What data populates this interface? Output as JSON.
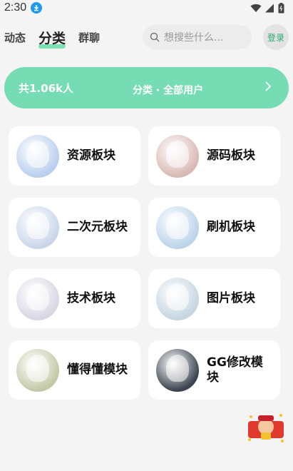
{
  "status": {
    "time": "2:30"
  },
  "header": {
    "tabs": [
      {
        "label": "动态",
        "active": false
      },
      {
        "label": "分类",
        "active": true
      },
      {
        "label": "群聊",
        "active": false
      }
    ],
    "search_placeholder": "想搜些什么...",
    "login_label": "登录"
  },
  "banner": {
    "count_text": "共1.06k人",
    "title": "分类 · 全部用户"
  },
  "categories": [
    {
      "label": "资源板块",
      "avatar_color": "#b9cfee"
    },
    {
      "label": "源码板块",
      "avatar_color": "#d8b9b4"
    },
    {
      "label": "二次元板块",
      "avatar_color": "#c9d6ea"
    },
    {
      "label": "刷机板块",
      "avatar_color": "#bcd3ea"
    },
    {
      "label": "技术板块",
      "avatar_color": "#d9d6e4"
    },
    {
      "label": "图片板块",
      "avatar_color": "#c6d5e0"
    },
    {
      "label": "懂得懂模块",
      "avatar_color": "#c2c9a6"
    },
    {
      "label": "GG修改模块",
      "avatar_color": "#3b4450"
    }
  ],
  "colors": {
    "accent": "#75dcb3",
    "login_text": "#2aa872"
  }
}
